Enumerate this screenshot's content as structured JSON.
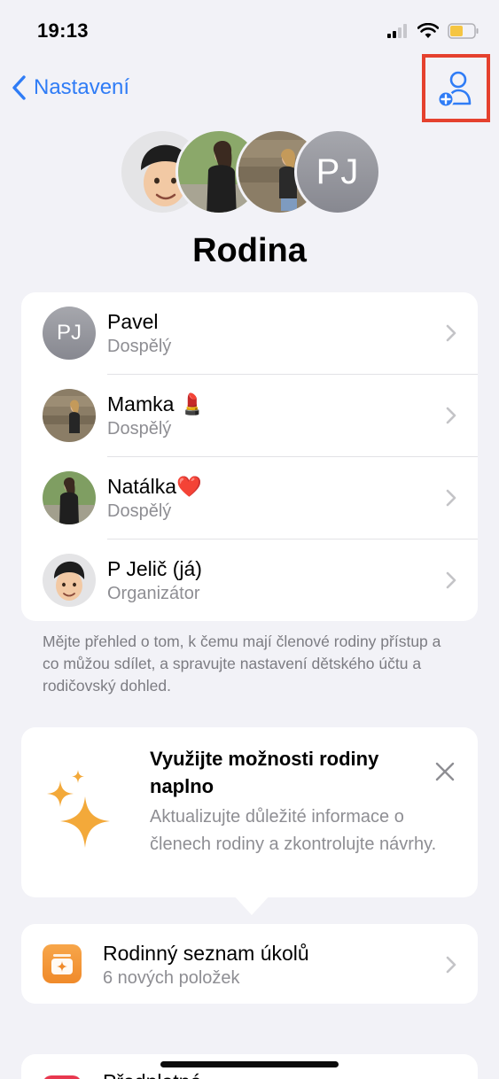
{
  "status_bar": {
    "time": "19:13"
  },
  "nav": {
    "back_label": "Nastavení",
    "add_member_icon": "person-add-icon"
  },
  "header": {
    "title": "Rodina",
    "initials": "PJ"
  },
  "members": [
    {
      "name": "Pavel",
      "role": "Dospělý",
      "initials": "PJ"
    },
    {
      "name": "Mamka 💄",
      "role": "Dospělý"
    },
    {
      "name": "Natálka❤️",
      "role": "Dospělý"
    },
    {
      "name": "P Jelič (já)",
      "role": "Organizátor"
    }
  ],
  "footnote": "Mějte přehled o tom, k čemu mají členové rodiny přístup a co můžou sdílet, a spravujte nastavení dětského účtu a rodičovský dohled.",
  "promo": {
    "title": "Využijte možnosti rodiny naplno",
    "description": "Aktualizujte důležité informace o členech rodiny a zkontrolujte návrhy."
  },
  "tasks": {
    "title": "Rodinný seznam úkolů",
    "subtitle": "6 nových položek"
  },
  "subscriptions": {
    "title": "Předplatné"
  },
  "colors": {
    "accent": "#2f7cf6",
    "highlight": "#e5412e",
    "background": "#f2f2f7",
    "sparkle": "#f3a93a",
    "tasks_icon": "#f08a2a"
  }
}
